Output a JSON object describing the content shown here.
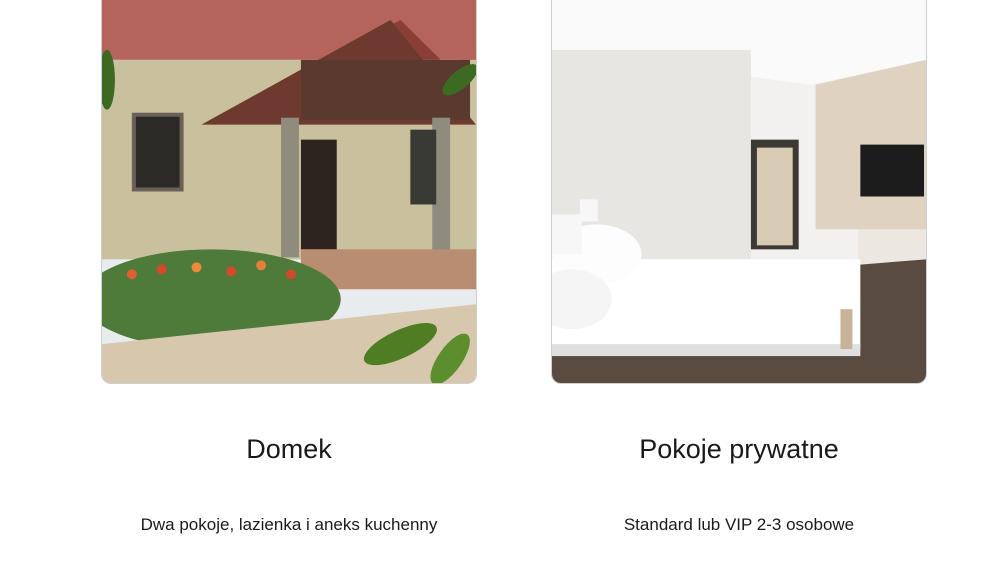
{
  "cards": [
    {
      "image_name": "house-photo",
      "title": "Domek",
      "description": "Dwa pokoje, lazienka i aneks kuchenny"
    },
    {
      "image_name": "hotel-room-photo",
      "title": "Pokoje prywatne",
      "description": "Standard lub VIP 2-3 osobowe"
    }
  ]
}
